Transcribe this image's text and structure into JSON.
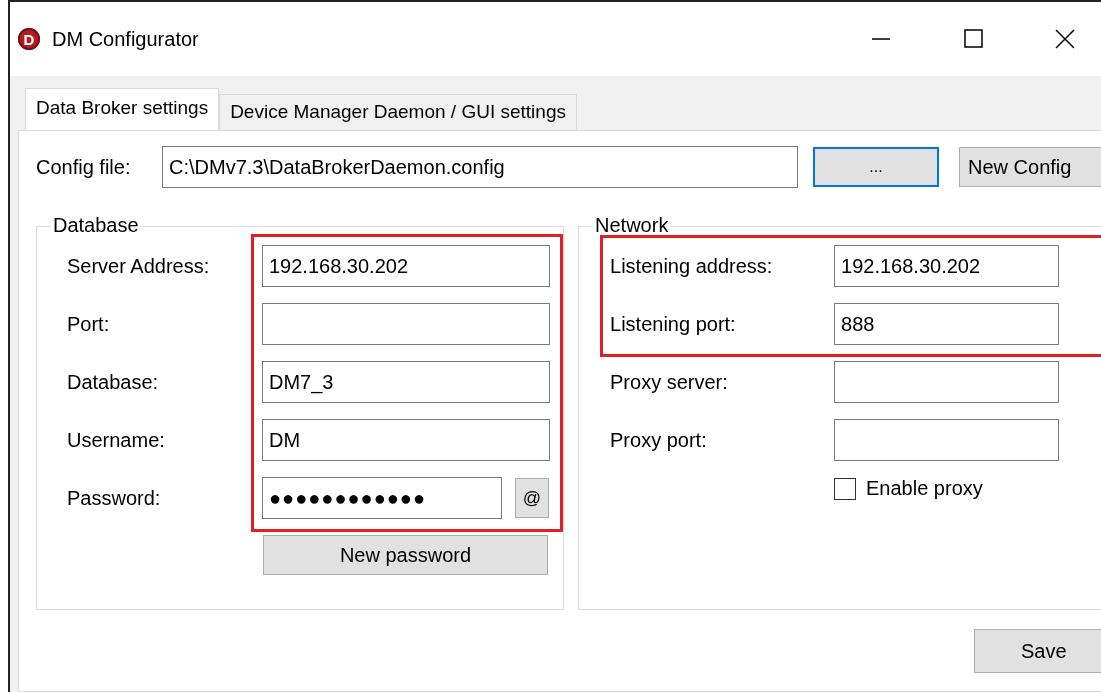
{
  "window": {
    "title": "DM Configurator",
    "logo_letter": "D"
  },
  "tabs": [
    {
      "label": "Data Broker settings",
      "selected": true
    },
    {
      "label": "Device Manager Daemon / GUI settings",
      "selected": false
    }
  ],
  "config_file": {
    "label": "Config file:",
    "value": "C:\\DMv7.3\\DataBrokerDaemon.config",
    "browse_button": {
      "label": "...",
      "focused": true
    },
    "new_button": {
      "label": "New Config",
      "focused": false
    }
  },
  "groups": [
    {
      "title": "Database",
      "frame": {
        "kind": "fields",
        "rows": [
          {
            "kind": "text",
            "label": "Server Address:",
            "value": "192.168.30.202"
          },
          {
            "kind": "text",
            "label": "Port:"
          },
          {
            "kind": "text",
            "label": "Database:",
            "value": "DM7_3"
          },
          {
            "kind": "text",
            "label": "Username:",
            "value": "DM"
          },
          {
            "kind": "password",
            "label": "Password:",
            "value": "●●●●●●●●●●●●",
            "reveal_button": "@"
          }
        ]
      },
      "rows": [
        {
          "kind": "button",
          "label": "New password"
        }
      ]
    },
    {
      "title": "Network",
      "frame": {
        "kind": "rows",
        "rows": [
          {
            "kind": "text",
            "label": "Listening address:",
            "value": "192.168.30.202"
          },
          {
            "kind": "text",
            "label": "Listening port:",
            "value": "888"
          }
        ]
      },
      "rows": [
        {
          "kind": "text",
          "label": "Proxy server:"
        },
        {
          "kind": "text",
          "label": "Proxy port:"
        },
        {
          "kind": "checkbox",
          "label": "Enable proxy",
          "checked": false
        }
      ]
    }
  ],
  "save_button": "Save"
}
